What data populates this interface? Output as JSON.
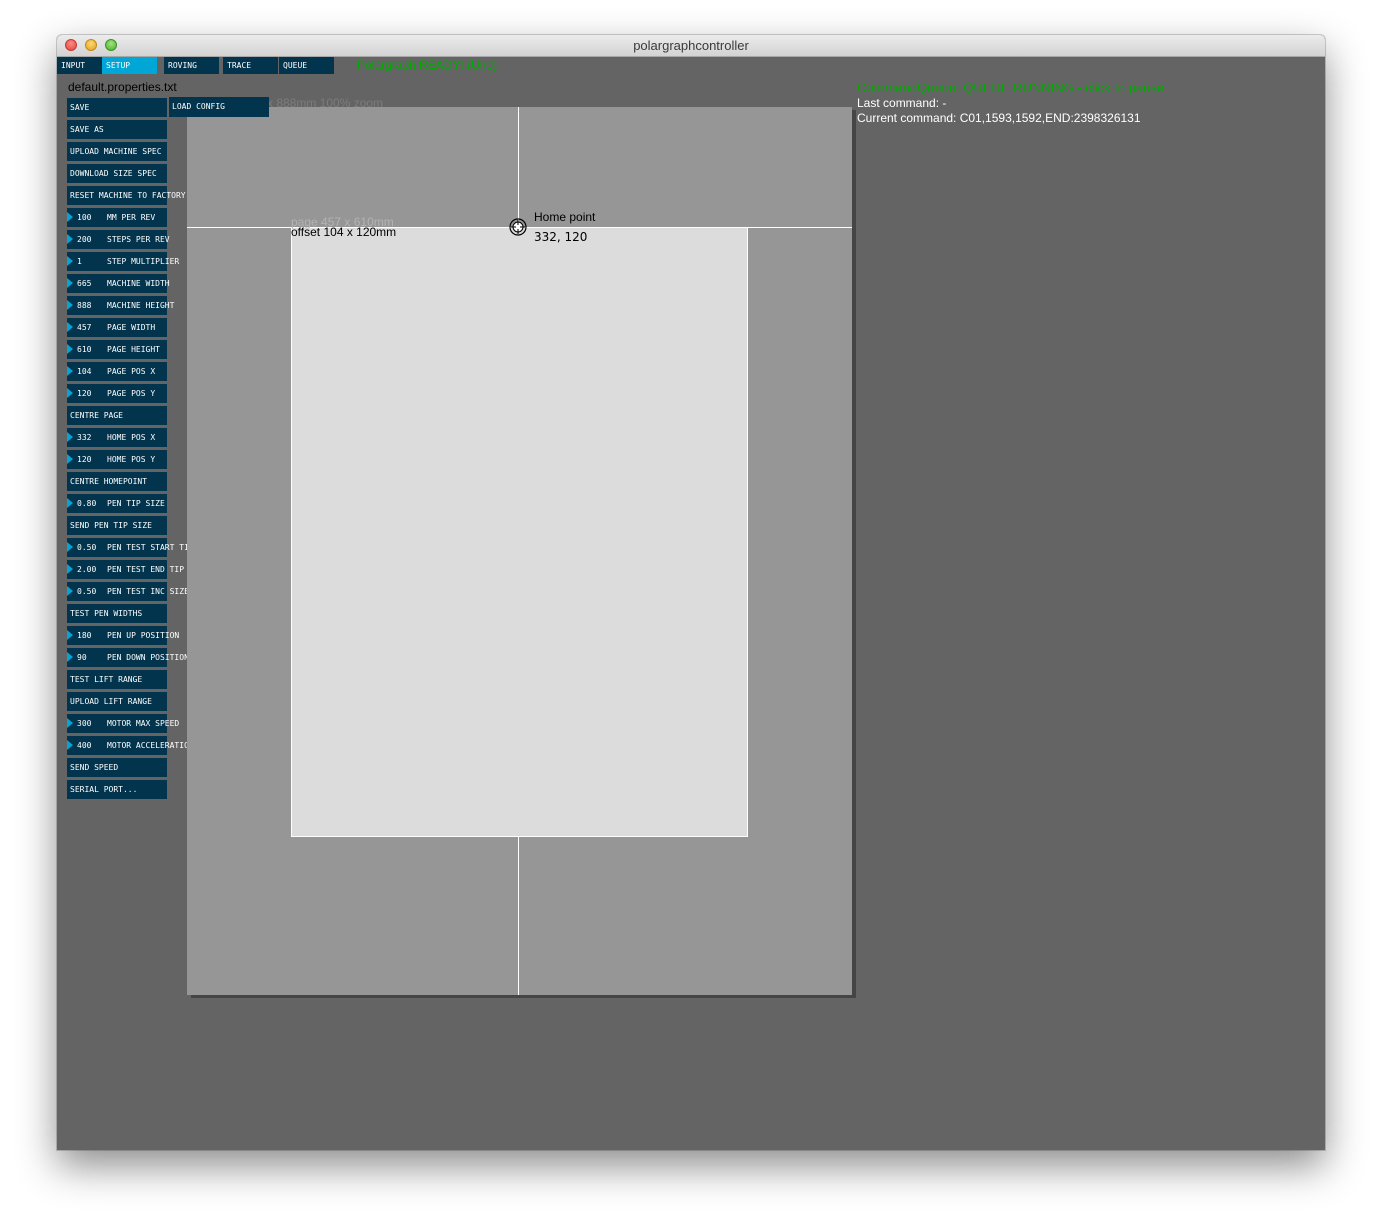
{
  "window": {
    "title": "polargraphcontroller"
  },
  "tabs": [
    {
      "label": "INPUT",
      "active": false
    },
    {
      "label": "SETUP",
      "active": true
    },
    {
      "label": "ROVING",
      "active": false
    },
    {
      "label": "TRACE",
      "active": false
    },
    {
      "label": "QUEUE",
      "active": false
    }
  ],
  "status": "Polargraph READY! (Uno)",
  "filename": "default.properties.txt",
  "load_config": "LOAD CONFIG",
  "zoom_label": "x 888mm 100% zoom",
  "controls": [
    {
      "label": "SAVE"
    },
    {
      "label": "SAVE AS"
    },
    {
      "label": "UPLOAD MACHINE SPEC"
    },
    {
      "label": "DOWNLOAD SIZE SPEC"
    },
    {
      "label": "RESET MACHINE TO FACTORY"
    },
    {
      "value": "100",
      "label": "MM PER REV"
    },
    {
      "value": "200",
      "label": "STEPS PER REV"
    },
    {
      "value": "1",
      "label": "STEP MULTIPLIER"
    },
    {
      "value": "665",
      "label": "MACHINE WIDTH"
    },
    {
      "value": "888",
      "label": "MACHINE HEIGHT"
    },
    {
      "value": "457",
      "label": "PAGE WIDTH"
    },
    {
      "value": "610",
      "label": "PAGE HEIGHT"
    },
    {
      "value": "104",
      "label": "PAGE POS X"
    },
    {
      "value": "120",
      "label": "PAGE POS Y"
    },
    {
      "label": "CENTRE PAGE"
    },
    {
      "value": "332",
      "label": "HOME POS X"
    },
    {
      "value": "120",
      "label": "HOME POS Y"
    },
    {
      "label": "CENTRE HOMEPOINT"
    },
    {
      "value": "0.80",
      "label": "PEN TIP SIZE"
    },
    {
      "label": "SEND PEN TIP SIZE"
    },
    {
      "value": "0.50",
      "label": "PEN TEST START TIP"
    },
    {
      "value": "2.00",
      "label": "PEN TEST END TIP"
    },
    {
      "value": "0.50",
      "label": "PEN TEST INC SIZE"
    },
    {
      "label": "TEST PEN WIDTHS"
    },
    {
      "value": "180",
      "label": "PEN UP POSITION"
    },
    {
      "value": "90",
      "label": "PEN DOWN POSITION"
    },
    {
      "label": "TEST LIFT RANGE"
    },
    {
      "label": "UPLOAD LIFT RANGE"
    },
    {
      "value": "300",
      "label": "MOTOR MAX SPEED"
    },
    {
      "value": "400",
      "label": "MOTOR ACCELERATION"
    },
    {
      "label": "SEND SPEED"
    },
    {
      "label": "SERIAL PORT..."
    }
  ],
  "canvas": {
    "page_label": "page 457 x 610mm",
    "offset_label": "offset 104 x 120mm",
    "home_label": "Home point",
    "home_coords": "332, 120"
  },
  "queue": {
    "status": "CommandQueue: QUEUE RUNNING - click to pause",
    "last_command": "Last command: -",
    "current_command": "Current command: C01,1593,1592,END:2398326131"
  },
  "colors": {
    "button_bg": "#02344d",
    "tab_active": "#00a6d6",
    "status_green": "#00aa00",
    "window_bg": "#646464",
    "machine_bg": "#969696",
    "page_bg": "#dcdcdc"
  },
  "icons": {
    "home_point": "crosshair-circle-icon",
    "value_marker": "triangle-right-icon"
  }
}
